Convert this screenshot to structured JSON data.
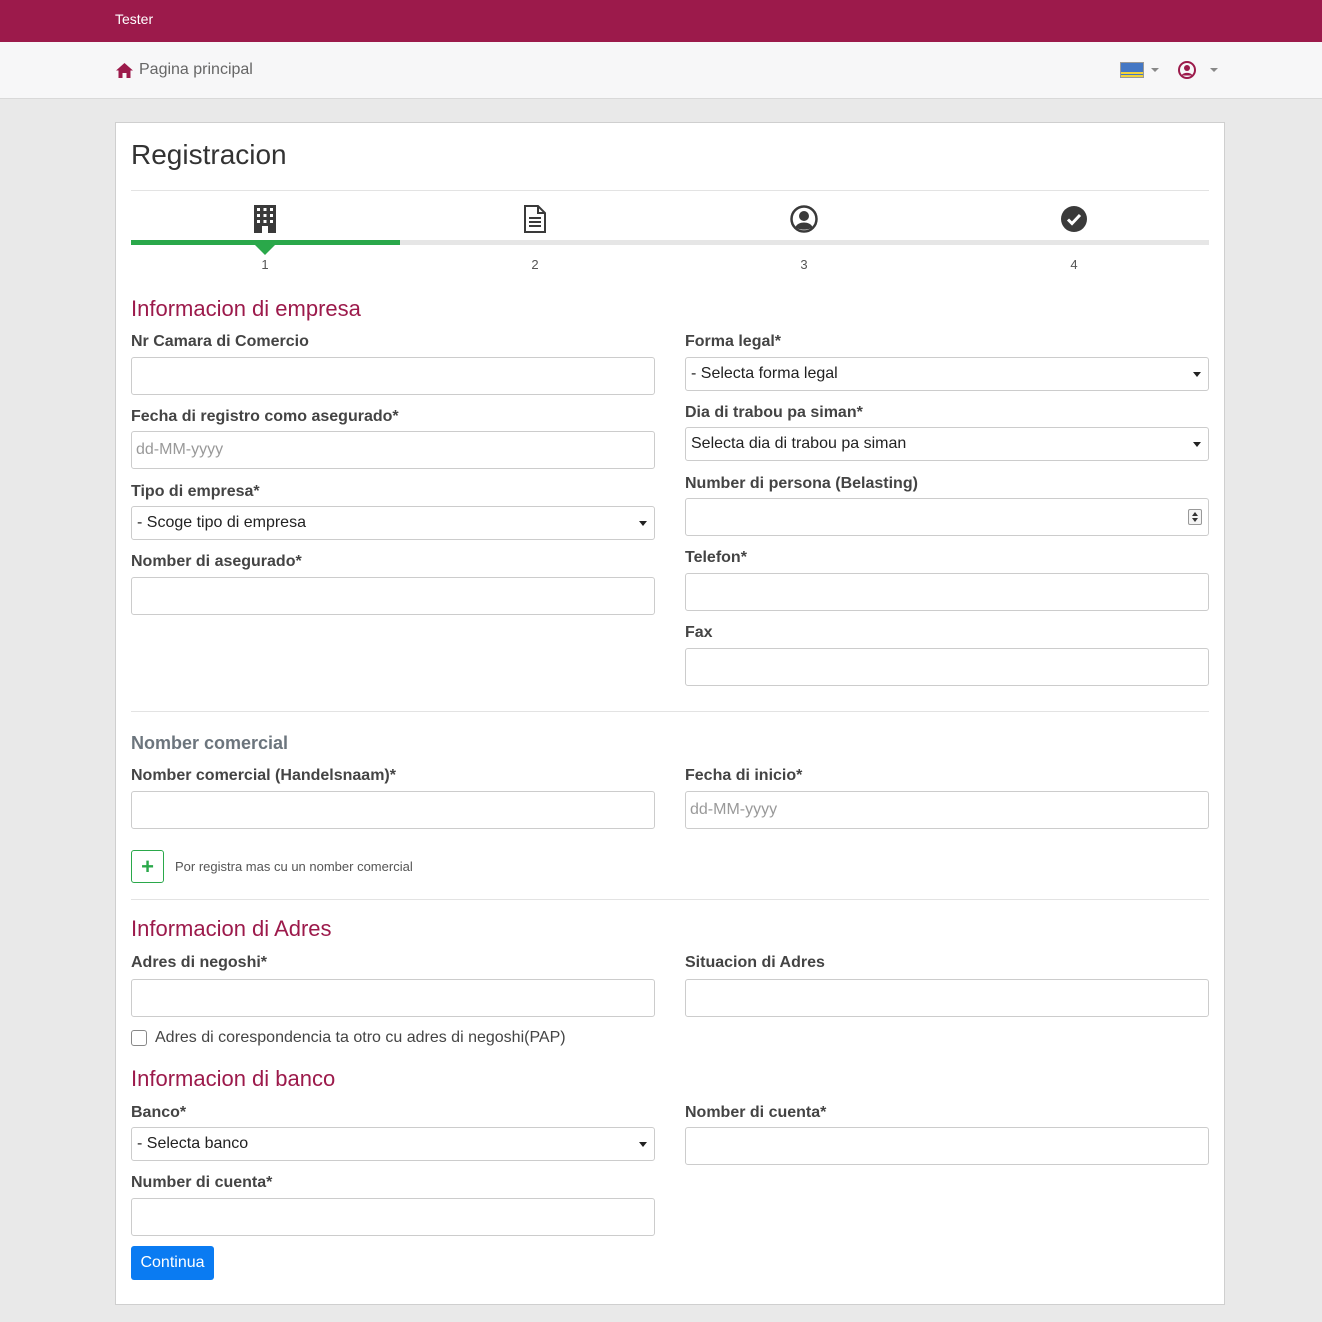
{
  "header": {
    "brand": "Tester"
  },
  "nav": {
    "home_label": "Pagina principal"
  },
  "page": {
    "title": "Registracion"
  },
  "steps": [
    "1",
    "2",
    "3",
    "4"
  ],
  "empresa": {
    "title": "Informacion di empresa",
    "nr_camara_label": "Nr Camara di Comercio",
    "fecha_registro_label": "Fecha di registro como asegurado*",
    "fecha_registro_placeholder": "dd-MM-yyyy",
    "tipo_label": "Tipo di empresa*",
    "tipo_value": "- Scoge tipo di empresa",
    "nomber_asegurado_label": "Nomber di asegurado*",
    "forma_legal_label": "Forma legal*",
    "forma_legal_value": "- Selecta forma legal",
    "dia_trabou_label": "Dia di trabou pa siman*",
    "dia_trabou_value": "Selecta dia di trabou pa siman",
    "number_persona_label": "Number di persona (Belasting)",
    "telefon_label": "Telefon*",
    "fax_label": "Fax"
  },
  "comercial": {
    "title": "Nomber comercial",
    "nomber_label": "Nomber comercial (Handelsnaam)*",
    "fecha_inicio_label": "Fecha di inicio*",
    "fecha_inicio_placeholder": "dd-MM-yyyy",
    "add_symbol": "+",
    "add_text": "Por registra mas cu un nomber comercial"
  },
  "adres": {
    "title": "Informacion di Adres",
    "negoshi_label": "Adres di negoshi*",
    "situacion_label": "Situacion di Adres",
    "checkbox_label": "Adres di corespondencia ta otro cu adres di negoshi(PAP)"
  },
  "banco": {
    "title": "Informacion di banco",
    "banco_label": "Banco*",
    "banco_value": "- Selecta banco",
    "number_cuenta_label": "Number di cuenta*",
    "nomber_cuenta_label": "Nomber di cuenta*"
  },
  "actions": {
    "continue_label": "Continua"
  },
  "colors": {
    "brand": "#9c1a4b",
    "step_active": "#2aa84a",
    "primary": "#0a7bf2"
  }
}
